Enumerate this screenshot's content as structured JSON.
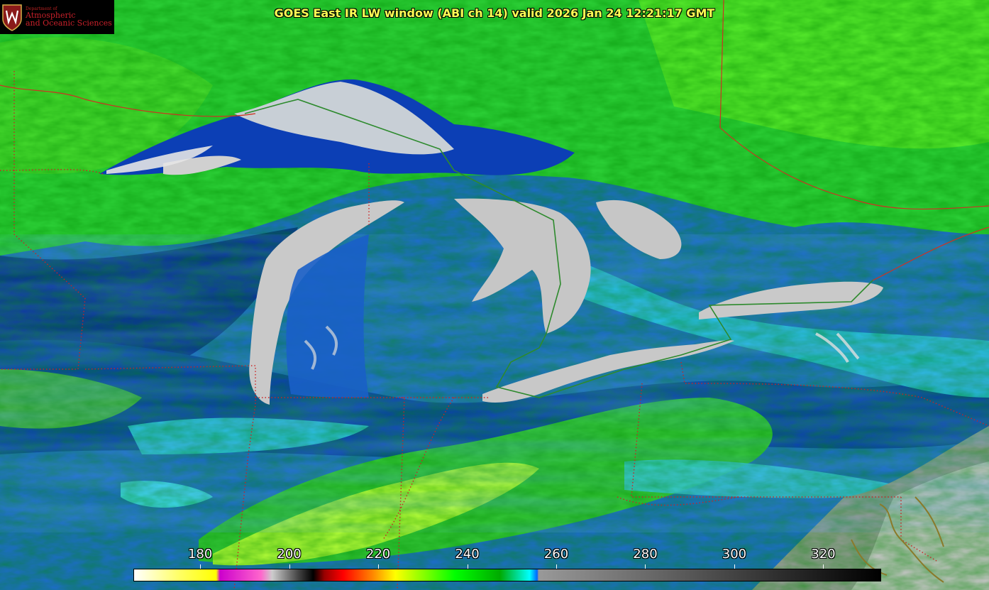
{
  "header": {
    "title": "GOES East IR LW window (ABI ch 14) valid 2026 Jan 24 12:21:17 GMT"
  },
  "logo": {
    "department": "Department of",
    "line1": "Atmospheric",
    "line2": "and Oceanic Sciences"
  },
  "colorbar": {
    "ticks": [
      "180",
      "200",
      "220",
      "240",
      "260",
      "280",
      "300",
      "320"
    ],
    "range": [
      165,
      333
    ]
  },
  "colors": {
    "title": "#ffff55",
    "borders": "#cc2222",
    "country_border": "#228822",
    "coast": "#8a7a2a",
    "logo_red": "#c8202a"
  }
}
